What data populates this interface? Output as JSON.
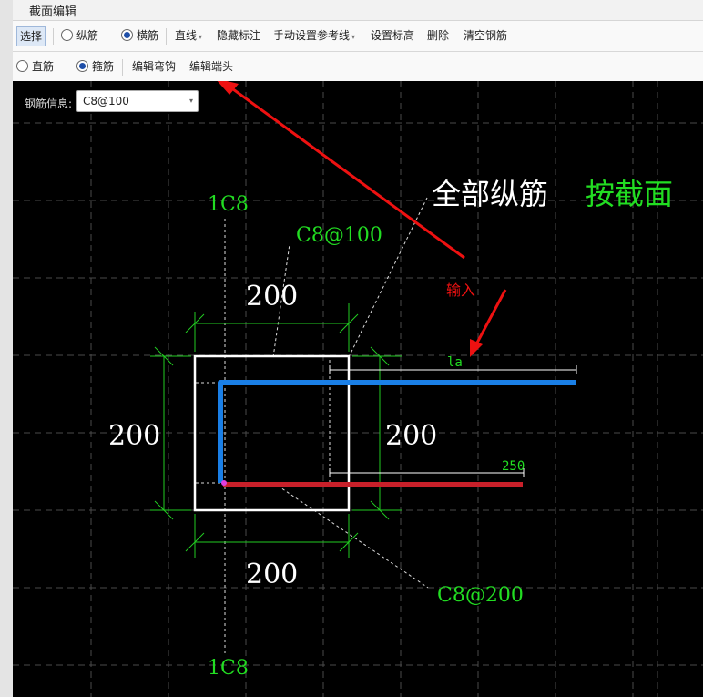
{
  "window": {
    "title": "截面编辑"
  },
  "toolbar1": {
    "select_label": "选择",
    "longitudinal_label": "纵筋",
    "transverse_label": "横筋",
    "line_label": "直线",
    "hide_annotation_label": "隐藏标注",
    "manual_refline_label": "手动设置参考线",
    "set_elevation_label": "设置标高",
    "delete_label": "删除",
    "clear_rebar_label": "清空钢筋"
  },
  "toolbar2": {
    "straight_label": "直筋",
    "stirrup_label": "箍筋",
    "edit_hook_label": "编辑弯钩",
    "edit_end_label": "编辑端头"
  },
  "rebar_info": {
    "label": "钢筋信息:",
    "value": "C8@100"
  },
  "drawing": {
    "top_rebar_label": "1C8",
    "bottom_rebar_label": "1C8",
    "stirrup_top_label": "C8@100",
    "stirrup_bottom_label": "C8@200",
    "dim_top": "200",
    "dim_left": "200",
    "dim_right": "200",
    "dim_bottom": "200",
    "dim_la": "la",
    "dim_250": "250",
    "note_all_longitudinal": "全部纵筋",
    "note_by_section": "按截面",
    "note_input": "输入"
  },
  "colors": {
    "blue_rebar": "#1a7fe6",
    "red_rebar": "#c8202a",
    "annotation_green": "#22dd22",
    "arrow_red": "#ee1111"
  }
}
